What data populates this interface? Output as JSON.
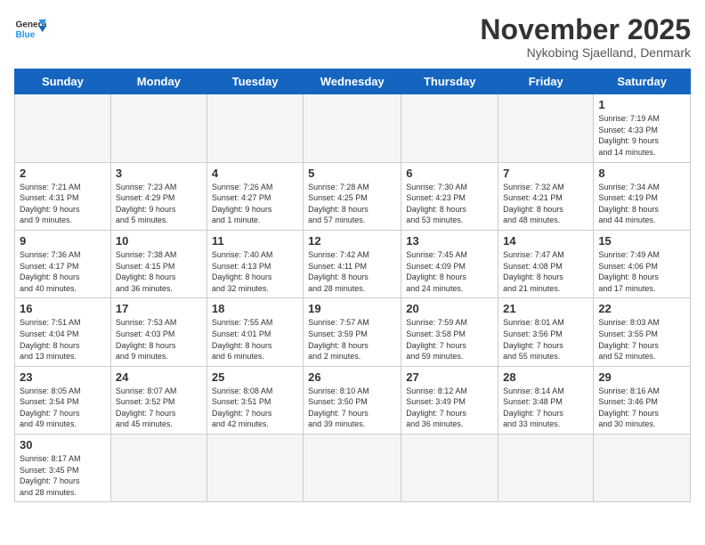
{
  "header": {
    "logo_general": "General",
    "logo_blue": "Blue",
    "month": "November 2025",
    "location": "Nykobing Sjaelland, Denmark"
  },
  "days_of_week": [
    "Sunday",
    "Monday",
    "Tuesday",
    "Wednesday",
    "Thursday",
    "Friday",
    "Saturday"
  ],
  "weeks": [
    [
      {
        "day": "",
        "info": ""
      },
      {
        "day": "",
        "info": ""
      },
      {
        "day": "",
        "info": ""
      },
      {
        "day": "",
        "info": ""
      },
      {
        "day": "",
        "info": ""
      },
      {
        "day": "",
        "info": ""
      },
      {
        "day": "1",
        "info": "Sunrise: 7:19 AM\nSunset: 4:33 PM\nDaylight: 9 hours\nand 14 minutes."
      }
    ],
    [
      {
        "day": "2",
        "info": "Sunrise: 7:21 AM\nSunset: 4:31 PM\nDaylight: 9 hours\nand 9 minutes."
      },
      {
        "day": "3",
        "info": "Sunrise: 7:23 AM\nSunset: 4:29 PM\nDaylight: 9 hours\nand 5 minutes."
      },
      {
        "day": "4",
        "info": "Sunrise: 7:26 AM\nSunset: 4:27 PM\nDaylight: 9 hours\nand 1 minute."
      },
      {
        "day": "5",
        "info": "Sunrise: 7:28 AM\nSunset: 4:25 PM\nDaylight: 8 hours\nand 57 minutes."
      },
      {
        "day": "6",
        "info": "Sunrise: 7:30 AM\nSunset: 4:23 PM\nDaylight: 8 hours\nand 53 minutes."
      },
      {
        "day": "7",
        "info": "Sunrise: 7:32 AM\nSunset: 4:21 PM\nDaylight: 8 hours\nand 48 minutes."
      },
      {
        "day": "8",
        "info": "Sunrise: 7:34 AM\nSunset: 4:19 PM\nDaylight: 8 hours\nand 44 minutes."
      }
    ],
    [
      {
        "day": "9",
        "info": "Sunrise: 7:36 AM\nSunset: 4:17 PM\nDaylight: 8 hours\nand 40 minutes."
      },
      {
        "day": "10",
        "info": "Sunrise: 7:38 AM\nSunset: 4:15 PM\nDaylight: 8 hours\nand 36 minutes."
      },
      {
        "day": "11",
        "info": "Sunrise: 7:40 AM\nSunset: 4:13 PM\nDaylight: 8 hours\nand 32 minutes."
      },
      {
        "day": "12",
        "info": "Sunrise: 7:42 AM\nSunset: 4:11 PM\nDaylight: 8 hours\nand 28 minutes."
      },
      {
        "day": "13",
        "info": "Sunrise: 7:45 AM\nSunset: 4:09 PM\nDaylight: 8 hours\nand 24 minutes."
      },
      {
        "day": "14",
        "info": "Sunrise: 7:47 AM\nSunset: 4:08 PM\nDaylight: 8 hours\nand 21 minutes."
      },
      {
        "day": "15",
        "info": "Sunrise: 7:49 AM\nSunset: 4:06 PM\nDaylight: 8 hours\nand 17 minutes."
      }
    ],
    [
      {
        "day": "16",
        "info": "Sunrise: 7:51 AM\nSunset: 4:04 PM\nDaylight: 8 hours\nand 13 minutes."
      },
      {
        "day": "17",
        "info": "Sunrise: 7:53 AM\nSunset: 4:03 PM\nDaylight: 8 hours\nand 9 minutes."
      },
      {
        "day": "18",
        "info": "Sunrise: 7:55 AM\nSunset: 4:01 PM\nDaylight: 8 hours\nand 6 minutes."
      },
      {
        "day": "19",
        "info": "Sunrise: 7:57 AM\nSunset: 3:59 PM\nDaylight: 8 hours\nand 2 minutes."
      },
      {
        "day": "20",
        "info": "Sunrise: 7:59 AM\nSunset: 3:58 PM\nDaylight: 7 hours\nand 59 minutes."
      },
      {
        "day": "21",
        "info": "Sunrise: 8:01 AM\nSunset: 3:56 PM\nDaylight: 7 hours\nand 55 minutes."
      },
      {
        "day": "22",
        "info": "Sunrise: 8:03 AM\nSunset: 3:55 PM\nDaylight: 7 hours\nand 52 minutes."
      }
    ],
    [
      {
        "day": "23",
        "info": "Sunrise: 8:05 AM\nSunset: 3:54 PM\nDaylight: 7 hours\nand 49 minutes."
      },
      {
        "day": "24",
        "info": "Sunrise: 8:07 AM\nSunset: 3:52 PM\nDaylight: 7 hours\nand 45 minutes."
      },
      {
        "day": "25",
        "info": "Sunrise: 8:08 AM\nSunset: 3:51 PM\nDaylight: 7 hours\nand 42 minutes."
      },
      {
        "day": "26",
        "info": "Sunrise: 8:10 AM\nSunset: 3:50 PM\nDaylight: 7 hours\nand 39 minutes."
      },
      {
        "day": "27",
        "info": "Sunrise: 8:12 AM\nSunset: 3:49 PM\nDaylight: 7 hours\nand 36 minutes."
      },
      {
        "day": "28",
        "info": "Sunrise: 8:14 AM\nSunset: 3:48 PM\nDaylight: 7 hours\nand 33 minutes."
      },
      {
        "day": "29",
        "info": "Sunrise: 8:16 AM\nSunset: 3:46 PM\nDaylight: 7 hours\nand 30 minutes."
      }
    ],
    [
      {
        "day": "30",
        "info": "Sunrise: 8:17 AM\nSunset: 3:45 PM\nDaylight: 7 hours\nand 28 minutes."
      },
      {
        "day": "",
        "info": ""
      },
      {
        "day": "",
        "info": ""
      },
      {
        "day": "",
        "info": ""
      },
      {
        "day": "",
        "info": ""
      },
      {
        "day": "",
        "info": ""
      },
      {
        "day": "",
        "info": ""
      }
    ]
  ]
}
